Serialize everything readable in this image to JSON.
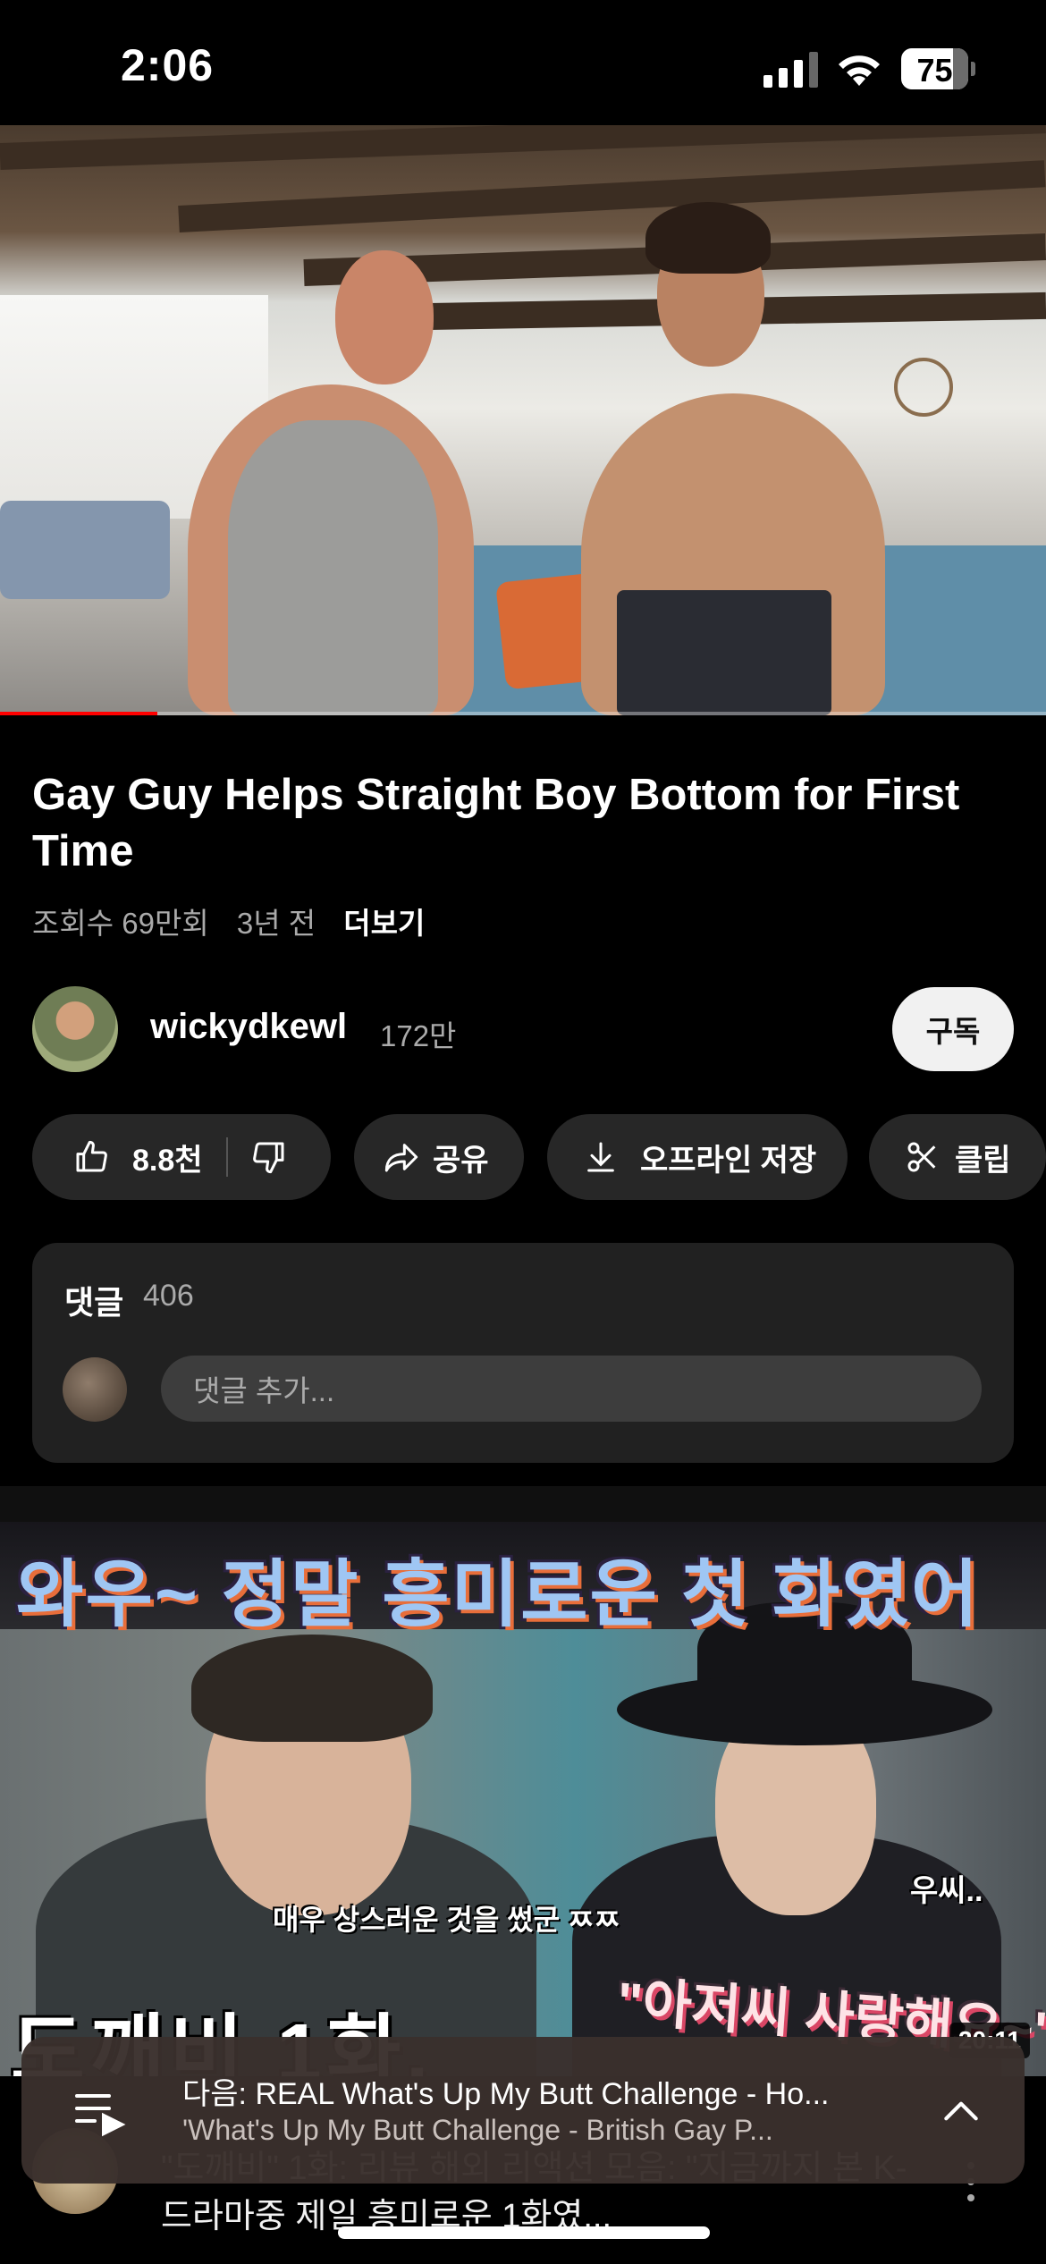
{
  "status_bar": {
    "time": "2:06",
    "battery": "75",
    "icons": [
      "cellular-signal-icon",
      "wifi-icon",
      "battery-icon"
    ]
  },
  "video": {
    "progress_fraction": 0.15,
    "title": "Gay Guy Helps Straight Boy Bottom for First Time",
    "views": "조회수 69만회",
    "age": "3년 전",
    "more": "더보기"
  },
  "channel": {
    "name": "wickydkewl",
    "subscribers": "172만",
    "subscribe_label": "구독"
  },
  "actions": {
    "like_count": "8.8천",
    "share": "공유",
    "download": "오프라인 저장",
    "clip": "클립"
  },
  "comments": {
    "label": "댓글",
    "count": "406",
    "placeholder": "댓글 추가..."
  },
  "next_thumbnail": {
    "headline": "와우~ 정말 흥미로운 첫 화였어",
    "caption_small": "매우 상스러운 것을 썼군 ㅉㅉ",
    "caption_right_top": "우씨..",
    "caption_big": "도깨비 1화.",
    "caption_right": "\"아저씨 사랑해요~\"",
    "duration": "20:11"
  },
  "next_item": {
    "title": "\"도깨비\" 1화: 리뷰 해외 리액션 모음: \"지금까지 본 K-드라마중 제일 흥미로운 1화였..."
  },
  "up_next": {
    "title": "다음: REAL What's Up My Butt Challenge - Ho...",
    "subtitle": "'What's Up My Butt Challenge - British Gay P..."
  },
  "colors": {
    "background": "#000000",
    "pill": "#272727",
    "card": "#212121",
    "progress": "#ff0000",
    "secondary_text": "#aaaaaa"
  }
}
